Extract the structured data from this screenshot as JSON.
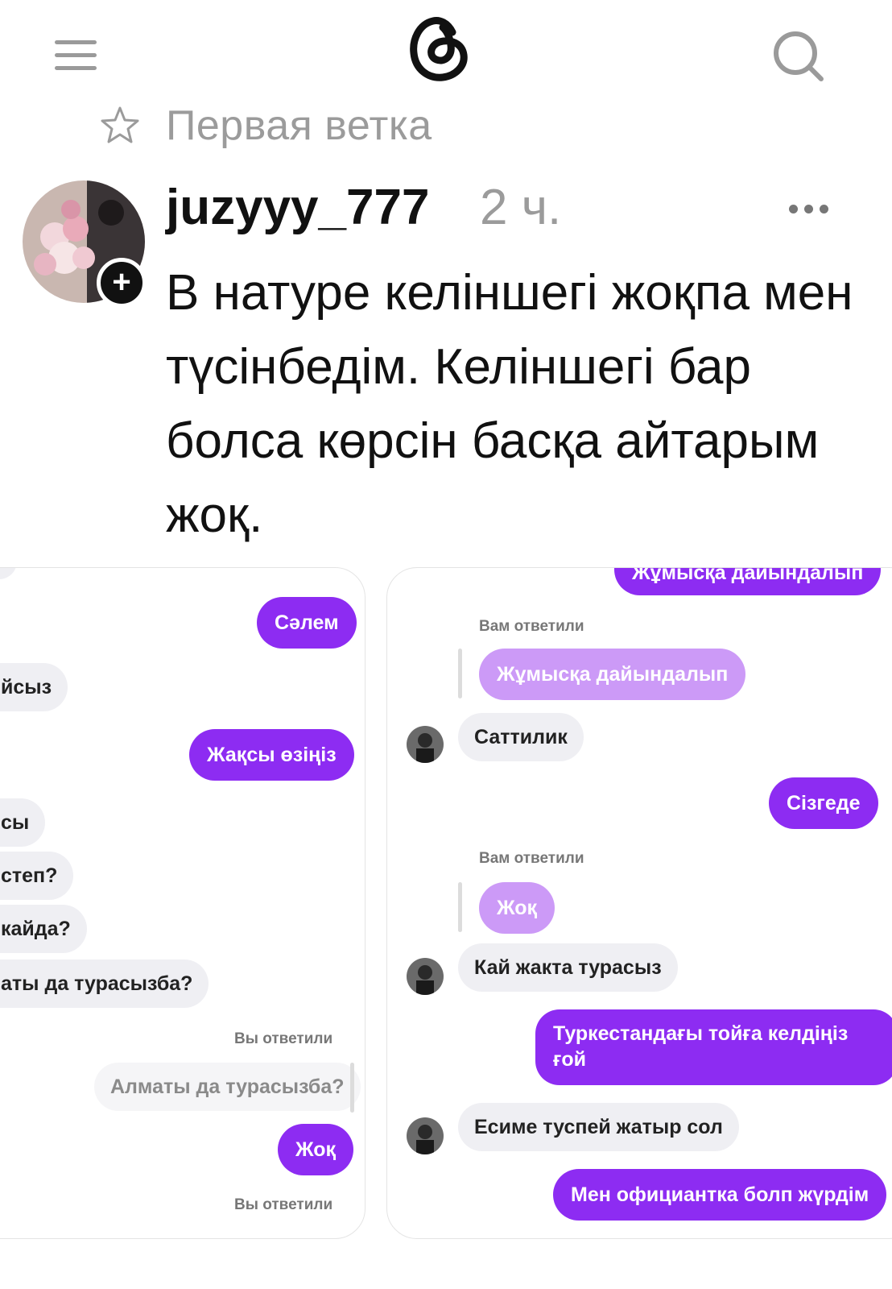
{
  "header": {
    "menu_icon": "hamburger-menu-icon",
    "logo_icon": "threads-logo-icon",
    "search_icon": "search-icon",
    "star_icon": "star-outline-icon",
    "thread_title": "Первая ветка"
  },
  "post": {
    "username": "juzyyy_777",
    "time": "2 ч.",
    "more": "···",
    "follow": "+",
    "text": "В натуре келіншегі жоқпа мен түсінбедім. Келіншегі бар болса көрсін басқа айтарым жоқ."
  },
  "left_chat": {
    "messages": [
      "Сәлем",
      "йсыз",
      "Жақсы өзіңіз",
      "сы",
      "степ?",
      "кайда?",
      "аты да турасызба?",
      "Вы ответили",
      "Алматы да турасызба?",
      "Жоқ",
      "Вы ответили"
    ]
  },
  "right_chat": {
    "messages": [
      "Жұмысқа дайындалып",
      "Вам ответили",
      "Жұмысқа дайындалып",
      "Саттилик",
      "Сізгеде",
      "Вам ответили",
      "Жоқ",
      "Кай жакта турасыз",
      "Туркестандағы тойға келдіңіз ғой",
      "Есиме туспей жатыр сол",
      "Мен официантка болп жүрдім"
    ]
  },
  "colors": {
    "accent_purple": "#8d2cf2",
    "faded_purple": "#cc9af7",
    "incoming_bubble": "#efeff3",
    "muted_text": "#9b9b9b"
  }
}
